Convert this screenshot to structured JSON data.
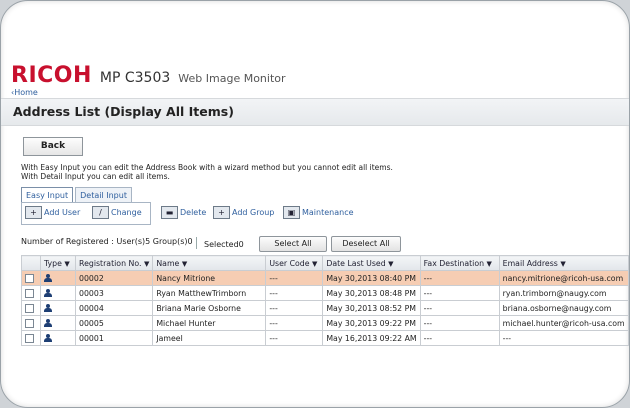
{
  "header": {
    "brand": "RICOH",
    "model": "MP C3503",
    "app": "Web Image Monitor",
    "home_link": "Home"
  },
  "page": {
    "title": "Address List (Display All Items)",
    "back_label": "Back",
    "info_line1": "With Easy Input you can edit the Address Book with a wizard method but you cannot edit all items.",
    "info_line2": "With Detail Input you can edit all items."
  },
  "tabs": [
    {
      "label": "Easy Input",
      "active": true
    },
    {
      "label": "Detail Input",
      "active": false
    }
  ],
  "toolbar": {
    "add_user": "Add User",
    "change": "Change",
    "delete": "Delete",
    "add_group": "Add Group",
    "maintenance": "Maintenance"
  },
  "counts": {
    "registered": "Number of Registered : User(s)5 Group(s)0",
    "selected": "Selected0",
    "select_all": "Select All",
    "deselect_all": "Deselect All"
  },
  "table": {
    "headers": [
      "",
      "Type",
      "Registration No.",
      "Name",
      "User Code",
      "Date Last Used",
      "Fax Destination",
      "Email Address"
    ],
    "rows": [
      {
        "reg": "00002",
        "name": "Nancy Mitrione",
        "code": "---",
        "date": "May 30,2013 08:40 PM",
        "fax": "---",
        "email": "nancy.mitrione@ricoh-usa.com",
        "highlight": true
      },
      {
        "reg": "00003",
        "name": "Ryan MatthewTrimborn",
        "code": "---",
        "date": "May 30,2013 08:48 PM",
        "fax": "---",
        "email": "ryan.trimborn@naugy.com",
        "highlight": false
      },
      {
        "reg": "00004",
        "name": "Briana Marie Osborne",
        "code": "---",
        "date": "May 30,2013 08:52 PM",
        "fax": "---",
        "email": "briana.osborne@naugy.com",
        "highlight": false
      },
      {
        "reg": "00005",
        "name": "Michael Hunter",
        "code": "---",
        "date": "May 30,2013 09:22 PM",
        "fax": "---",
        "email": "michael.hunter@ricoh-usa.com",
        "highlight": false
      },
      {
        "reg": "00001",
        "name": "Jameel",
        "code": "---",
        "date": "May 16,2013 09:22 AM",
        "fax": "---",
        "email": "---",
        "highlight": false
      }
    ]
  },
  "colors": {
    "brand_red": "#c8102e",
    "highlight_row": "#f6cdb3",
    "link_blue": "#2f5f9e"
  }
}
